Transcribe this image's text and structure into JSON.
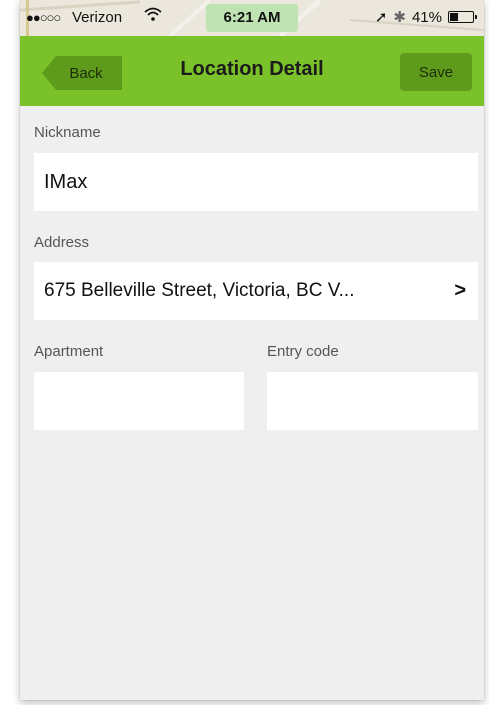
{
  "status_bar": {
    "signal_dots": "●●○○○",
    "carrier": "Verizon",
    "wifi_icon": "wifi-icon",
    "time": "6:21 AM",
    "battery_percent": "41%",
    "battery_level": 0.41
  },
  "nav": {
    "back_label": "Back",
    "title": "Location Detail",
    "save_label": "Save"
  },
  "form": {
    "nickname": {
      "label": "Nickname",
      "value": "IMax"
    },
    "address": {
      "label": "Address",
      "value": "675 Belleville Street, Victoria, BC V..."
    },
    "apartment": {
      "label": "Apartment",
      "value": ""
    },
    "entry_code": {
      "label": "Entry code",
      "value": ""
    }
  },
  "colors": {
    "nav_green": "#7bc12a",
    "button_green": "#5e9b1c",
    "background": "#efefef"
  }
}
